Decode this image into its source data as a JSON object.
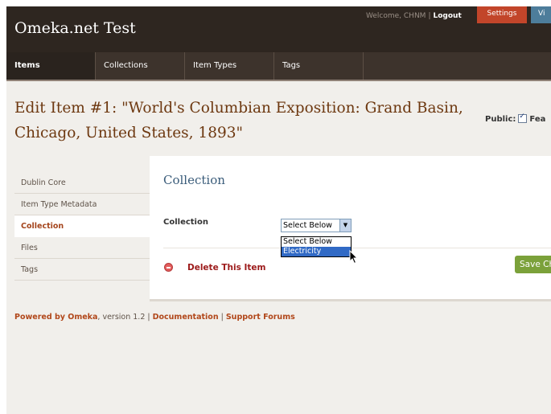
{
  "header": {
    "site_title": "Omeka.net Test",
    "welcome_text": "Welcome, CHNM",
    "separator": "|",
    "logout_label": "Logout",
    "settings_label": "Settings",
    "view_label": "Vi"
  },
  "nav": {
    "tabs": [
      {
        "label": "Items",
        "active": true
      },
      {
        "label": "Collections"
      },
      {
        "label": "Item Types"
      },
      {
        "label": "Tags"
      }
    ]
  },
  "page": {
    "title": "Edit Item #1: \"World's Columbian Exposition: Grand Basin, Chicago, United States, 1893\"",
    "public_label": "Public:",
    "featured_label": "Fea"
  },
  "sidebar": {
    "items": [
      {
        "label": "Dublin Core"
      },
      {
        "label": "Item Type Metadata"
      },
      {
        "label": "Collection",
        "active": true
      },
      {
        "label": "Files"
      },
      {
        "label": "Tags"
      }
    ]
  },
  "panel": {
    "title": "Collection",
    "collection_label": "Collection",
    "select_value": "Select Below",
    "options": [
      "Select Below",
      "Electricity"
    ],
    "highlighted_option": "Electricity",
    "delete_label": "Delete This Item",
    "save_label": "Save Ch"
  },
  "footer": {
    "powered_by": "Powered by Omeka",
    "version": ", version 1.2 |",
    "documentation": "Documentation",
    "sep": "|",
    "support": "Support Forums"
  },
  "colors": {
    "header_bg": "#2e2620",
    "settings_bg": "#c2452a",
    "title_color": "#6d3810",
    "save_bg": "#7ba13a",
    "delete_color": "#9c1a1a"
  }
}
